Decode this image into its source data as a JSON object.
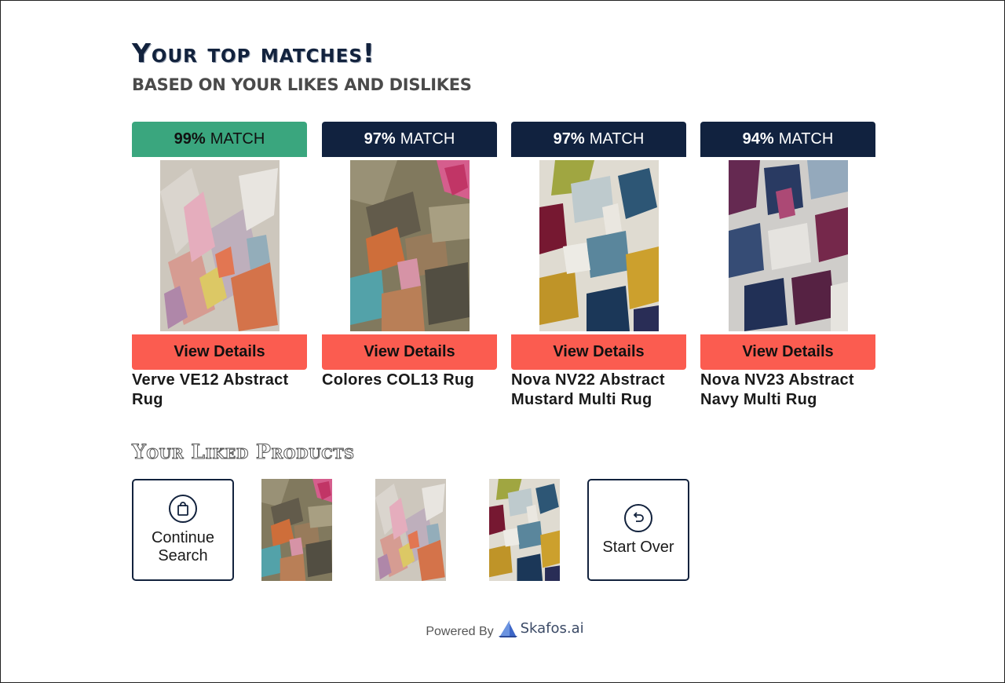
{
  "header": {
    "title": "Your top matches!",
    "subtitle": "BASED ON YOUR LIKES AND DISLIKES"
  },
  "matches": [
    {
      "percent": "99%",
      "suffix": "MATCH",
      "button": "View Details",
      "name": "Verve VE12 Abstract Rug",
      "badge_color": "#3aa67e",
      "rug_icon": "verve-rug"
    },
    {
      "percent": "97%",
      "suffix": "MATCH",
      "button": "View Details",
      "name": "Colores COL13 Rug",
      "badge_color": "#11223f",
      "rug_icon": "colores-rug"
    },
    {
      "percent": "97%",
      "suffix": "MATCH",
      "button": "View Details",
      "name": "Nova NV22 Abstract Mustard Multi Rug",
      "badge_color": "#11223f",
      "rug_icon": "nova-mustard-rug"
    },
    {
      "percent": "94%",
      "suffix": "MATCH",
      "button": "View Details",
      "name": "Nova NV23 Abstract Navy Multi Rug",
      "badge_color": "#11223f",
      "rug_icon": "nova-navy-rug"
    }
  ],
  "liked": {
    "title": "Your Liked Products",
    "continue_label": "Continue Search",
    "start_over_label": "Start Over",
    "thumbs": [
      "colores-rug",
      "verve-rug",
      "nova-mustard-rug"
    ]
  },
  "footer": {
    "powered_by": "Powered By",
    "brand": "Skafos.ai"
  },
  "colors": {
    "navy": "#11223f",
    "green": "#3aa67e",
    "coral": "#fb5c50"
  }
}
